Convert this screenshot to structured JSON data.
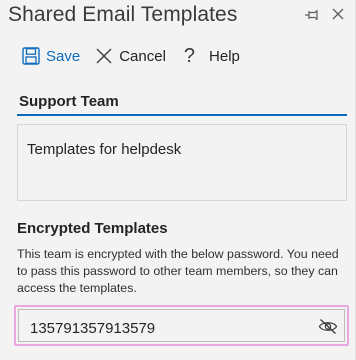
{
  "header": {
    "title": "Shared Email Templates",
    "pin_icon": "pin-icon",
    "close_icon": "close-icon"
  },
  "toolbar": {
    "save_label": "Save",
    "cancel_label": "Cancel",
    "help_label": "Help",
    "help_glyph": "?"
  },
  "team": {
    "name": "Support Team",
    "description": "Templates for helpdesk"
  },
  "encryption": {
    "heading": "Encrypted Templates",
    "description": "This team is encrypted with the below password. You need to pass this password to other team members, so they can access the templates.",
    "password": "135791357913579",
    "visibility_icon": "eye-slash-icon"
  },
  "colors": {
    "accent": "#0f6cbd",
    "focus_ring": "#e9a7e1",
    "background": "#f3f3f3"
  }
}
